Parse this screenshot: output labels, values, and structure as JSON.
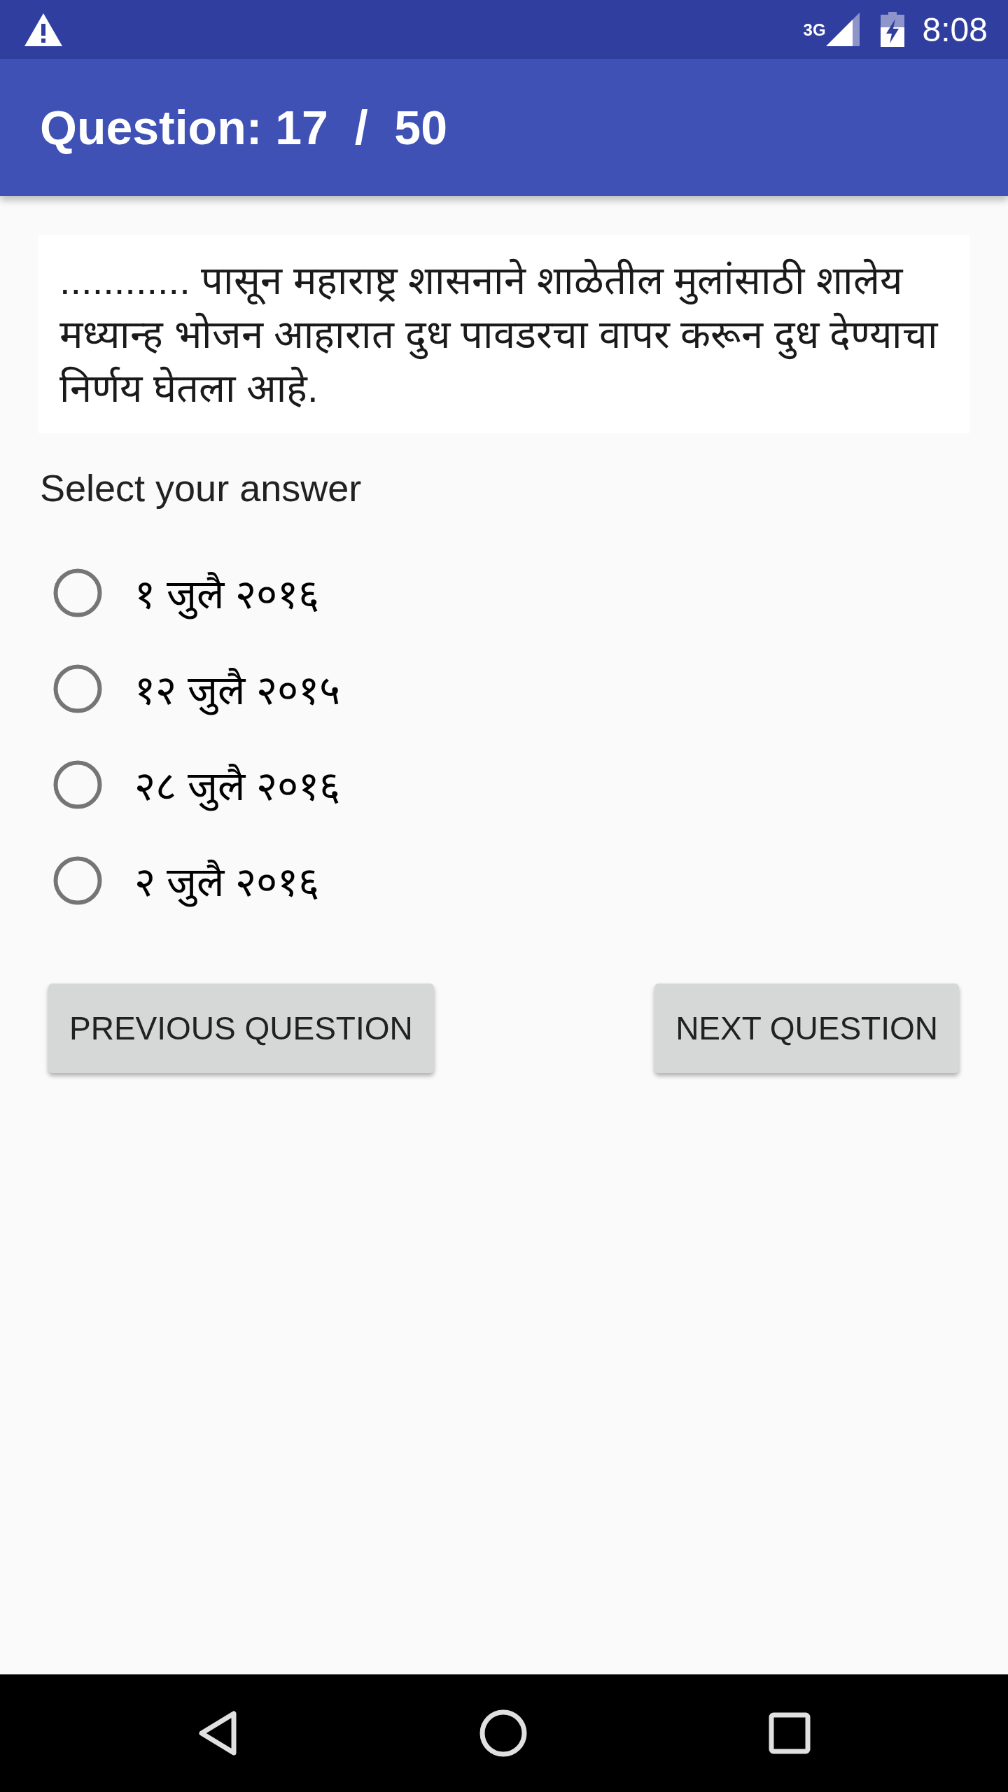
{
  "status_bar": {
    "network": "3G",
    "time": "8:08"
  },
  "app_bar": {
    "title": "Question: 17  /  50"
  },
  "question": {
    "text": "............ पासून महाराष्ट्र शासनाने शाळेतील मुलांसाठी शालेय मध्यान्ह भोजन आहारात दुध पावडरचा वापर करून दुध देण्याचा निर्णय घेतला आहे."
  },
  "prompt": "Select your answer",
  "options": [
    {
      "label": "१ जुलै २०१६",
      "selected": false
    },
    {
      "label": "१२ जुलै २०१५",
      "selected": false
    },
    {
      "label": "२८ जुलै २०१६",
      "selected": false
    },
    {
      "label": "२ जुलै २०१६",
      "selected": false
    }
  ],
  "buttons": [
    {
      "label": "PREVIOUS QUESTION"
    },
    {
      "label": "NEXT QUESTION"
    }
  ]
}
